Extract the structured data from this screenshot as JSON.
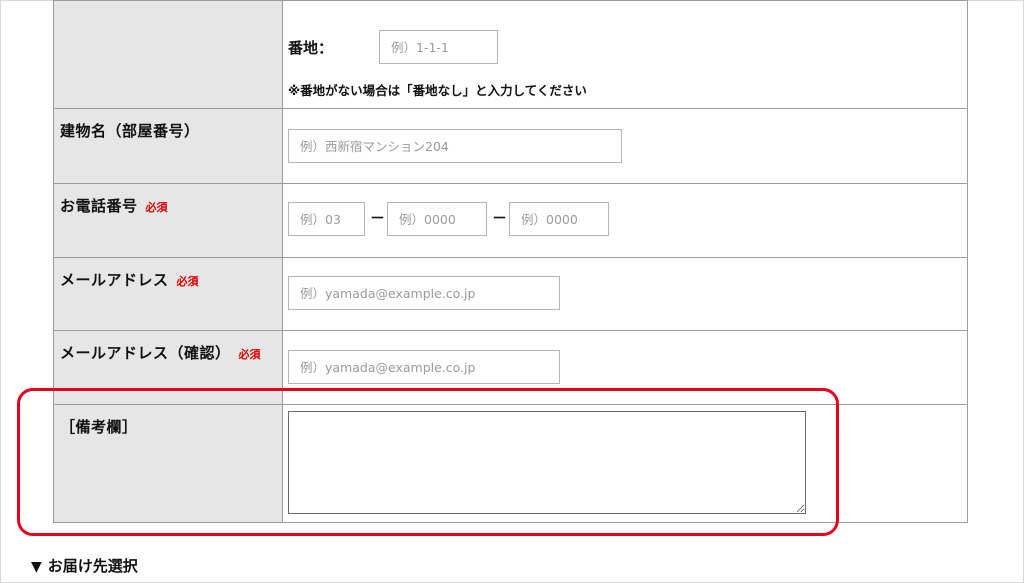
{
  "address": {
    "banchi_label": "番地：",
    "banchi_placeholder": "例）1-1-1",
    "note": "※番地がない場合は「番地なし」と入力してください"
  },
  "building": {
    "label": "建物名（部屋番号）",
    "placeholder": "例）西新宿マンション204"
  },
  "phone": {
    "label": "お電話番号",
    "required": "必須",
    "placeholder_1": "例）03",
    "placeholder_2": "例）0000",
    "placeholder_3": "例）0000",
    "separator": "－"
  },
  "email": {
    "label": "メールアドレス",
    "required": "必須",
    "placeholder": "例）yamada@example.co.jp"
  },
  "email_confirm": {
    "label": "メールアドレス（確認）",
    "required": "必須",
    "placeholder": "例）yamada@example.co.jp"
  },
  "remarks": {
    "label": "［備考欄］"
  },
  "delivery": {
    "heading_icon": "▼",
    "heading": "お届け先選択"
  },
  "colors": {
    "highlight": "#e8001e",
    "required": "#e00000",
    "label_bg": "#e6e6e6"
  }
}
